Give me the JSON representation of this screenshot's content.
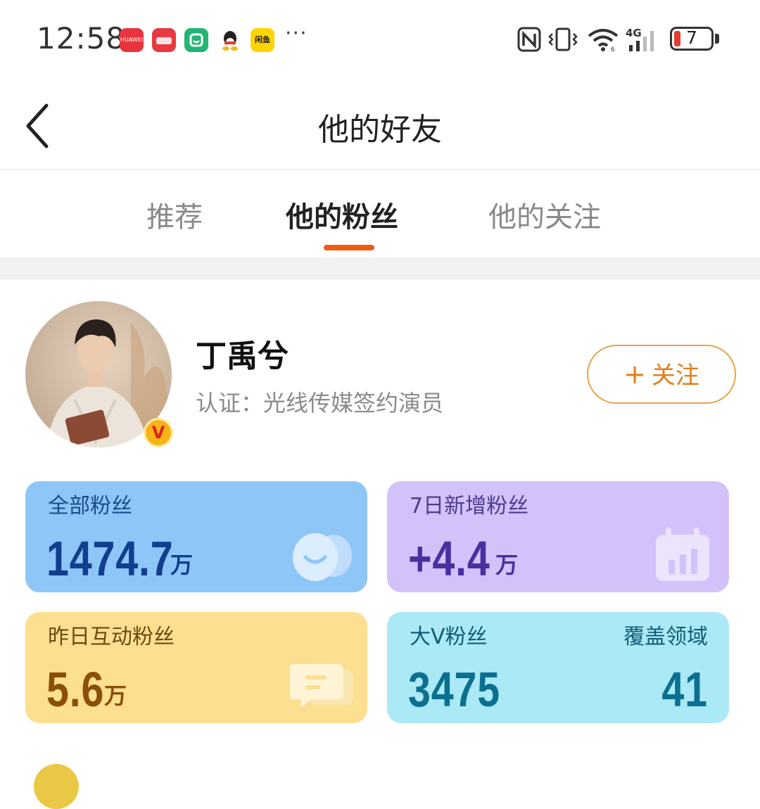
{
  "status_bar": {
    "time": "12:58",
    "app_icons": [
      {
        "name": "huawei-app-icon",
        "color": "#e8343c",
        "label": "HUAWEI"
      },
      {
        "name": "wallet-app-icon",
        "color": "#e8343c",
        "label": ""
      },
      {
        "name": "mi-home-app-icon",
        "color": "#22b573",
        "label": ""
      },
      {
        "name": "qq-app-icon",
        "color": "#ffffff",
        "label": ""
      },
      {
        "name": "xianyu-app-icon",
        "color": "#ffd400",
        "label": "闲鱼"
      }
    ],
    "more": "···",
    "battery_level": "7"
  },
  "header": {
    "title": "他的好友",
    "back_icon": "chevron-left-icon"
  },
  "tabs": [
    {
      "label": "推荐",
      "active": false
    },
    {
      "label": "他的粉丝",
      "active": true
    },
    {
      "label": "他的关注",
      "active": false
    }
  ],
  "profile": {
    "name": "丁禹兮",
    "verification": "认证：光线传媒签约演员",
    "verified_badge": "V",
    "follow_button": {
      "icon": "+",
      "label": "关注"
    }
  },
  "stats": {
    "total_fans": {
      "label": "全部粉丝",
      "value": "1474.7",
      "unit": "万",
      "icon": "users-icon"
    },
    "new_fans_7d": {
      "label": "7日新增粉丝",
      "value": "+4.4",
      "unit": "万",
      "icon": "calendar-chart-icon"
    },
    "active_fans_yesterday": {
      "label": "昨日互动粉丝",
      "value": "5.6",
      "unit": "万",
      "icon": "chat-icon"
    },
    "big_v_fans": {
      "label": "大V粉丝",
      "value": "3475",
      "coverage_label": "覆盖领域",
      "coverage_value": "41"
    }
  },
  "colors": {
    "accent_orange": "#f05a14",
    "card_blue": "#8ec6f8",
    "card_purple": "#d3c2fa",
    "card_yellow": "#fddf92",
    "card_cyan": "#abe9f6"
  }
}
